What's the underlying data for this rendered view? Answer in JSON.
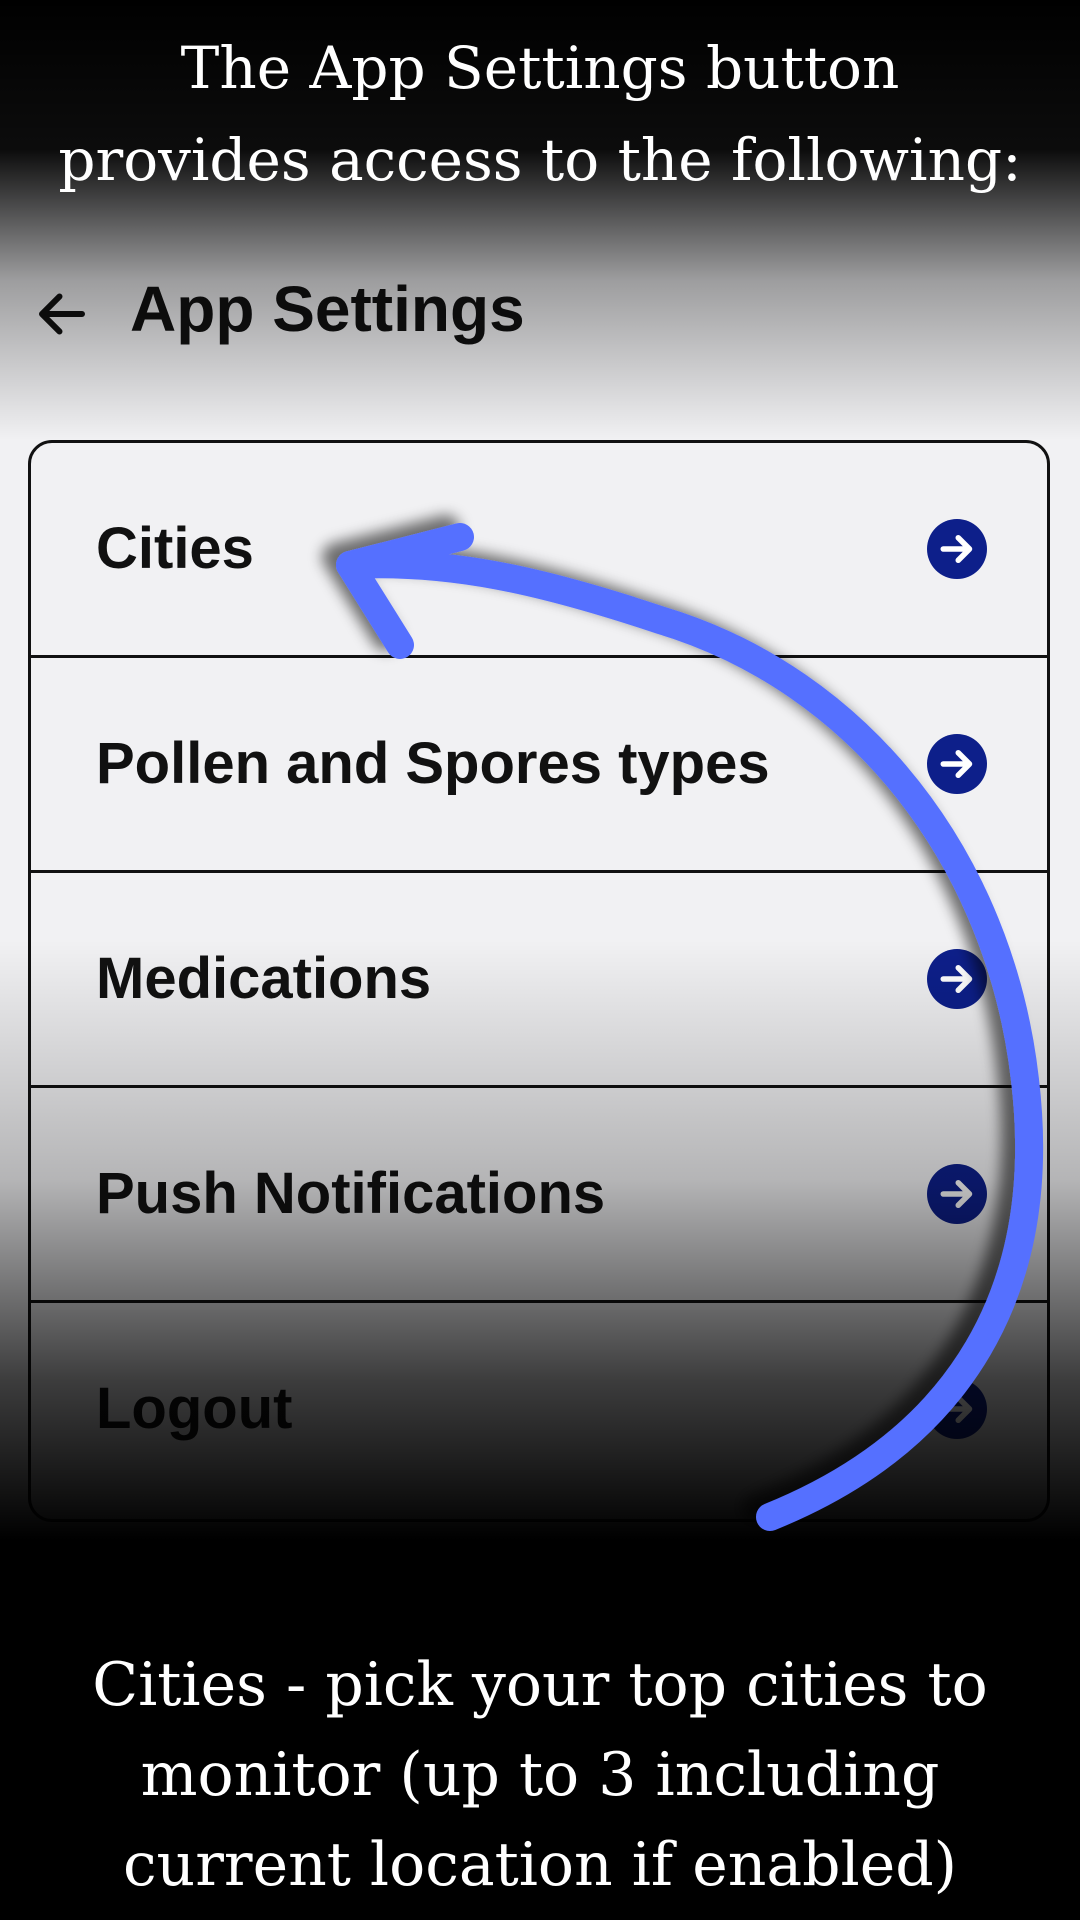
{
  "captions": {
    "top_line1": "The App Settings button",
    "top_line2": "provides access to the following:",
    "bottom_line1": "Cities - pick your top cities to",
    "bottom_line2": "monitor (up to 3 including",
    "bottom_line3": "current location if enabled)"
  },
  "header": {
    "back_icon": "arrow-left-icon",
    "title": "App Settings"
  },
  "settings": {
    "items": [
      {
        "label": "Cities",
        "icon": "arrow-right-circle-icon"
      },
      {
        "label": "Pollen and Spores types",
        "icon": "arrow-right-circle-icon"
      },
      {
        "label": "Medications",
        "icon": "arrow-right-circle-icon"
      },
      {
        "label": "Push Notifications",
        "icon": "arrow-right-circle-icon"
      },
      {
        "label": "Logout",
        "icon": "arrow-right-circle-icon"
      }
    ]
  },
  "colors": {
    "accent_icon": "#0d1f8a",
    "annotation_arrow": "#5570ff",
    "background": "#f1f1f3"
  }
}
